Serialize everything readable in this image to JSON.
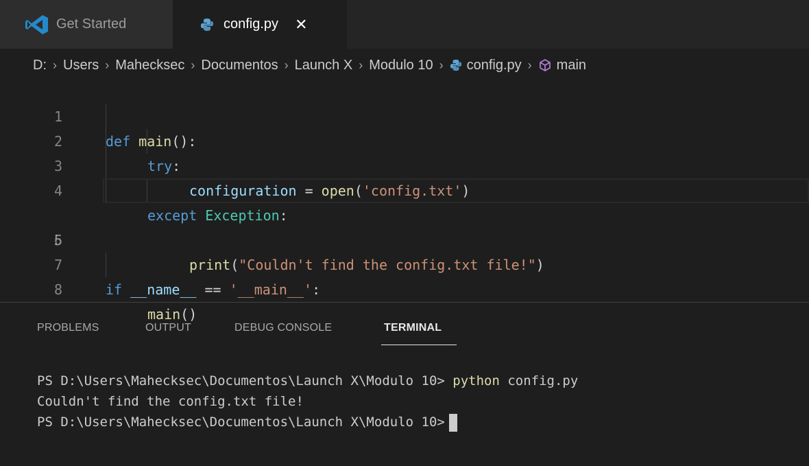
{
  "tabs": [
    {
      "label": "Get Started",
      "icon": "vscode-icon"
    },
    {
      "label": "config.py",
      "icon": "python-icon",
      "close_glyph": "✕"
    }
  ],
  "breadcrumb": {
    "items": [
      "D:",
      "Users",
      "Mahecksec",
      "Documentos",
      "Launch X",
      "Modulo 10",
      "config.py",
      "main"
    ],
    "separator": "›"
  },
  "editor": {
    "active_line": 5,
    "lines": [
      {
        "number": "1"
      },
      {
        "number": "2"
      },
      {
        "number": "3"
      },
      {
        "number": "4"
      },
      {
        "number": "5"
      },
      {
        "number": "6"
      },
      {
        "number": "7"
      },
      {
        "number": "8"
      }
    ],
    "tokens": {
      "l1_def": "def",
      "l1_main": "main",
      "l1_paren": "():",
      "l2_try": "try",
      "l2_colon": ":",
      "l3_var": "configuration",
      "l3_eq": " = ",
      "l3_open": "open",
      "l3_p1": "(",
      "l3_str": "'config.txt'",
      "l3_p2": ")",
      "l4_except": "except",
      "l4_exc": "Exception",
      "l4_colon": ":",
      "l5_print": "print",
      "l5_p1": "(",
      "l5_str": "\"Couldn't find the config.txt file!\"",
      "l5_p2": ")",
      "l7_if": "if",
      "l7_name": "__name__",
      "l7_eq": " == ",
      "l7_str": "'__main__'",
      "l7_colon": ":",
      "l8_main": "main",
      "l8_paren": "()"
    }
  },
  "panel": {
    "tabs": [
      "PROBLEMS",
      "OUTPUT",
      "DEBUG CONSOLE",
      "TERMINAL"
    ],
    "active_tab": "TERMINAL"
  },
  "terminal": {
    "prompt": "PS D:\\Users\\Mahecksec\\Documentos\\Launch X\\Modulo 10> ",
    "command": "python",
    "command_args": " config.py",
    "output": "Couldn't find the config.txt file!",
    "prompt2": "PS D:\\Users\\Mahecksec\\Documentos\\Launch X\\Modulo 10>"
  },
  "colors": {
    "background": "#1e1e1e",
    "keyword": "#569cd6",
    "function": "#dcdcaa",
    "string": "#ce9178",
    "variable": "#9cdcfe",
    "class": "#4ec9b0"
  }
}
